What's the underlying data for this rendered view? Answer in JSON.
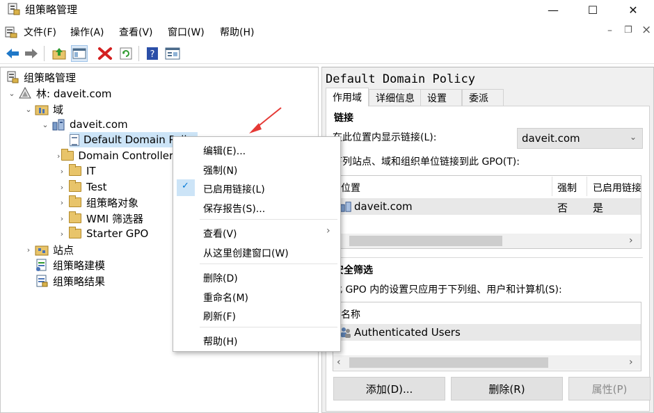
{
  "window": {
    "title": "组策略管理",
    "minimize_glyph": "—",
    "maximize_glyph": "☐",
    "close_glyph": "✕"
  },
  "menubar": {
    "items": [
      "文件(F)",
      "操作(A)",
      "查看(V)",
      "窗口(W)",
      "帮助(H)"
    ],
    "mdi_minimize": "–",
    "mdi_restore": "❐",
    "mdi_close": "×"
  },
  "toolbar": {
    "icons": [
      "back-icon",
      "forward-icon",
      "up-folder-icon",
      "show-hide-tree-icon",
      "delete-icon",
      "refresh-icon",
      "help-icon",
      "properties-icon"
    ]
  },
  "tree": {
    "root": "组策略管理",
    "forest": "林: daveit.com",
    "domains": "域",
    "domain": "daveit.com",
    "default_policy": "Default Domain Policy",
    "domain_controllers": "Domain Controllers",
    "it": "IT",
    "test": "Test",
    "gpo_objects": "组策略对象",
    "wmi_filters": "WMI 筛选器",
    "starter_gpo": "Starter GPO",
    "sites": "站点",
    "modeling": "组策略建模",
    "results": "组策略结果"
  },
  "context_menu": {
    "edit": "编辑(E)...",
    "enforce": "强制(N)",
    "link_enabled": "已启用链接(L)",
    "save_report": "保存报告(S)...",
    "view": "查看(V)",
    "new_window": "从这里创建窗口(W)",
    "delete": "删除(D)",
    "rename": "重命名(M)",
    "refresh": "刷新(F)",
    "help": "帮助(H)",
    "check_glyph": "✓",
    "submenu_glyph": "›"
  },
  "details": {
    "policy_title": "Default Domain Policy",
    "tabs": [
      "作用域",
      "详细信息",
      "设置",
      "委派"
    ],
    "links_heading": "链接",
    "display_links_label": "在此位置内显示链接(L):",
    "display_links_value": "daveit.com",
    "linked_text": "下列站点、域和组织单位链接到此 GPO(T):",
    "links_columns": [
      "位置",
      "强制",
      "已启用链接"
    ],
    "links_rows": [
      {
        "location": "daveit.com",
        "enforced": "否",
        "enabled": "是"
      }
    ],
    "security_heading": "安全筛选",
    "security_text": "此 GPO 内的设置只应用于下列组、用户和计算机(S):",
    "security_column": "名称",
    "security_rows": [
      "Authenticated Users"
    ],
    "add_button": "添加(D)...",
    "remove_button": "删除(R)",
    "properties_button": "属性(P)",
    "scroll_left": "‹",
    "scroll_right": "›"
  },
  "colors": {
    "selection": "#cce4f7",
    "arrow": "#e53935",
    "accent": "#0078d7"
  }
}
